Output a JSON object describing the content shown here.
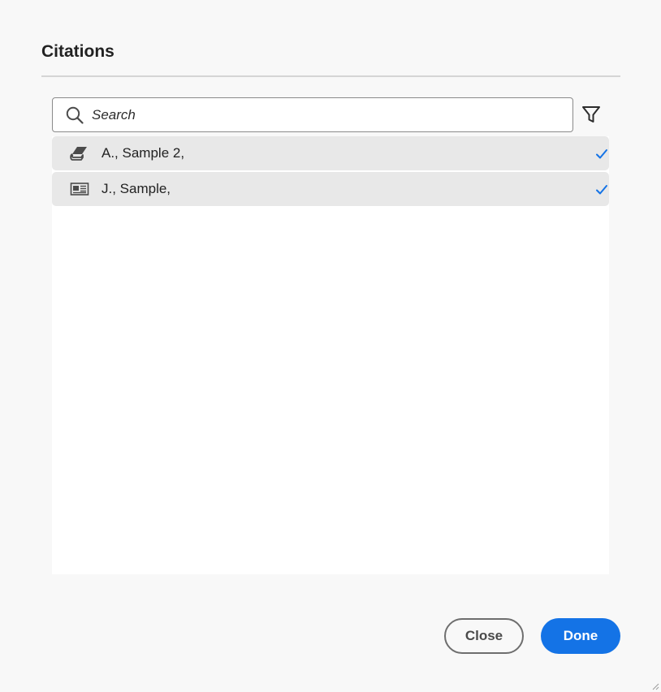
{
  "dialog": {
    "title": "Citations"
  },
  "search": {
    "placeholder": "Search",
    "value": "",
    "icon": "search-icon"
  },
  "filter": {
    "icon": "filter-icon"
  },
  "citations": [
    {
      "label": "A., Sample 2,",
      "icon": "book-icon",
      "selected": true
    },
    {
      "label": "J., Sample,",
      "icon": "newspaper-icon",
      "selected": true
    }
  ],
  "buttons": {
    "close_label": "Close",
    "done_label": "Done"
  },
  "colors": {
    "accent": "#1473e6",
    "check": "#1473e6",
    "selected_row": "#e8e8e8",
    "background": "#f8f8f8"
  }
}
